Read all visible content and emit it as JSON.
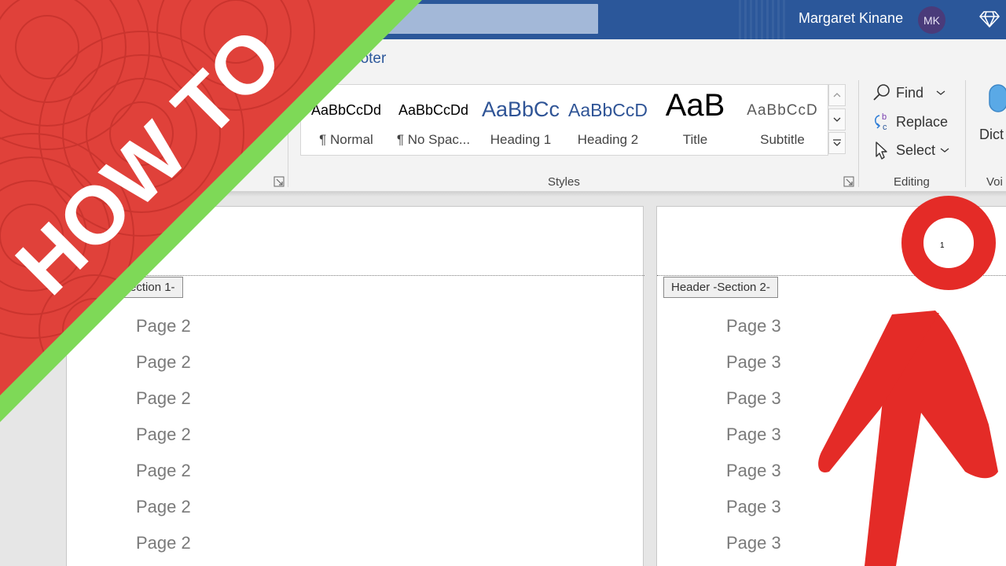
{
  "titlebar": {
    "user_name": "Margaret Kinane",
    "avatar_initials": "MK",
    "color": "#2b579a"
  },
  "ribbon": {
    "partial_tab_label": "ooter",
    "styles": [
      {
        "sample": "AaBbCcDd",
        "name": "¶ Normal"
      },
      {
        "sample": "AaBbCcDd",
        "name": "¶ No Spac..."
      },
      {
        "sample": "AaBbCc",
        "name": "Heading 1"
      },
      {
        "sample": "AaBbCcD",
        "name": "Heading 2"
      },
      {
        "sample": "AaB",
        "name": "Title"
      },
      {
        "sample": "AaBbCcD",
        "name": "Subtitle"
      }
    ],
    "styles_group_label": "Styles",
    "editing": {
      "find": "Find",
      "replace": "Replace",
      "select": "Select",
      "group_label": "Editing"
    },
    "voice": {
      "dictate_label": "Dict",
      "group_label": "Voi"
    }
  },
  "document": {
    "left_page": {
      "header_tag": "Section 1-",
      "lines": [
        "Page 2",
        "Page 2",
        "Page 2",
        "Page 2",
        "Page 2",
        "Page 2",
        "Page 2"
      ]
    },
    "right_page": {
      "header_tag": "Header -Section 2-",
      "page_number": "1",
      "lines": [
        "Page 3",
        "Page 3",
        "Page 3",
        "Page 3",
        "Page 3",
        "Page 3",
        "Page 3"
      ]
    }
  },
  "overlay": {
    "banner_text": "HOW TO",
    "banner_color": "#e0413a",
    "stripe_color": "#7ed957",
    "annotation_color": "#e42b27"
  }
}
